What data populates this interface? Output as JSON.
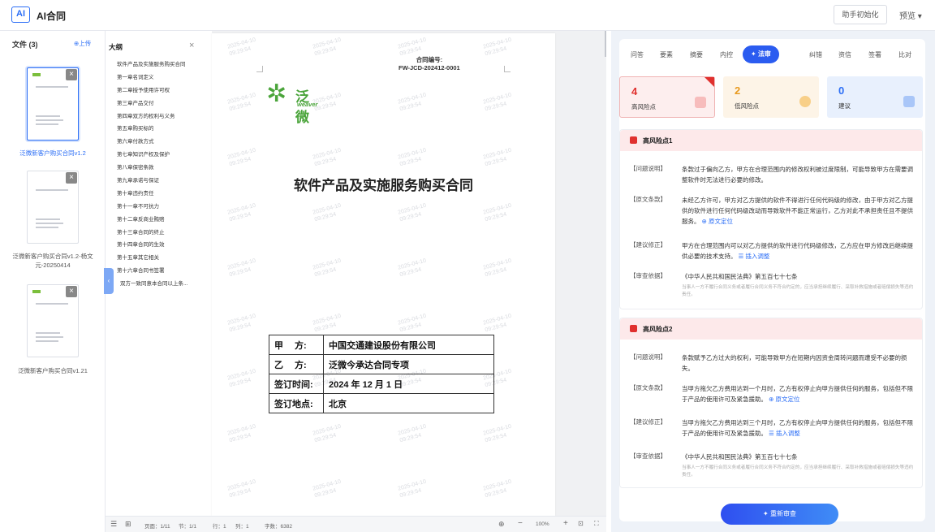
{
  "app": {
    "logo": "AI",
    "title": "AI合同",
    "init_button": "助手初始化",
    "preview_button": "预览 ▾"
  },
  "files": {
    "title": "文件 (3)",
    "upload": "⊕上传",
    "items": [
      {
        "name": "泛微新客户购买合同v1.2"
      },
      {
        "name": "泛微新客户购买合同v1.2-杨文元-20250414"
      },
      {
        "name": "泛微新客户购买合同v1.21"
      }
    ]
  },
  "outline": {
    "title": "大纲",
    "items": [
      "软件产品及实施服务购买合同",
      "第一章名词定义",
      "第二章授予使用许可权",
      "第三章产品交付",
      "第四章双方的权利与义务",
      "第五章购买标的",
      "第六章付款方式",
      "第七章知识产权及保护",
      "第八章保密条款",
      "第九章承诺与保证",
      "第十章违约责任",
      "第十一章不可抗力",
      "第十二章反商业贿赂",
      "第十三章合同的终止",
      "第十四章合同的生效",
      "第十五章其它相关",
      "第十六章合同书签署",
      "双方一致同意本合同以上条..."
    ]
  },
  "document": {
    "contract_no_label": "合同编号:",
    "contract_no": "FW-JCD-202412-0001",
    "brand_cn": "泛微",
    "brand_en": "weaver",
    "title": "软件产品及实施服务购买合同",
    "watermark_date": "2025-04-10",
    "watermark_time": "09:29:54",
    "parties": [
      {
        "k": "甲　 方:",
        "v": "中国交通建设股份有限公司"
      },
      {
        "k": "乙　 方:",
        "v": "泛微今承达合同专项"
      },
      {
        "k": "签订时间:",
        "v": "2024 年 12 月 1 日"
      },
      {
        "k": "签订地点:",
        "v": "北京"
      }
    ]
  },
  "statusbar": {
    "page": "页面：1/11",
    "section": "节：1/1",
    "row": "行：1",
    "col": "列：1",
    "words": "字数：6382",
    "zoom": "100%"
  },
  "review": {
    "tabs": [
      "问答",
      "要素",
      "摘要",
      "内控",
      "法审",
      "纠错",
      "资信",
      "签署",
      "比对"
    ],
    "active_tab": "法审",
    "stats": [
      {
        "num": "4",
        "label": "高风险点",
        "color": "#e0302e"
      },
      {
        "num": "2",
        "label": "低风险点",
        "color": "#e89a1f"
      },
      {
        "num": "0",
        "label": "建议",
        "color": "#2b6ef6"
      }
    ],
    "risks": [
      {
        "title": "高风险点1",
        "issue_k": "【问题说明】",
        "issue": "条款过于偏向乙方，甲方在合理范围内的修改权利被过度限制，可能导致甲方在需要调整软件时无法进行必要的修改。",
        "orig_k": "【原文条款】",
        "orig": "未经乙方许可，甲方对乙方提供的软件不得进行任何代码级的修改，由于甲方对乙方提供的软件进行任何代码级改动而导致软件不能正常运行，乙方对此不承担责任且不提供服务。",
        "orig_link": "⊕ 原文定位",
        "fix_k": "【建议修正】",
        "fix": "甲方在合理范围内可以对乙方提供的软件进行代码级修改，乙方应在甲方修改后继续提供必要的技术支持。",
        "fix_link": "☰ 插入调整",
        "basis_k": "【审查依据】",
        "basis": "《中华人民共和国民法典》第五百七十七条",
        "basis_detail": "当事人一方不履行合同义务或者履行合同义务不符合约定的，应当承担继续履行、采取补救措施或者赔偿损失等违约责任。"
      },
      {
        "title": "高风险点2",
        "issue_k": "【问题说明】",
        "issue": "条款赋予乙方过大的权利，可能导致甲方在短期内因资金周转问题而遭受不必要的损失。",
        "orig_k": "【原文条款】",
        "orig": "当甲方拖欠乙方费用达到一个月时，乙方有权停止向甲方提供任何的服务，包括但不限于产品的使用许可及紧急援助。",
        "orig_link": "⊕ 原文定位",
        "fix_k": "【建议修正】",
        "fix": "当甲方拖欠乙方费用达到三个月时，乙方有权停止向甲方提供任何的服务，包括但不限于产品的使用许可及紧急援助。",
        "fix_link": "☰ 插入调整",
        "basis_k": "【审查依据】",
        "basis": "《中华人民共和国民法典》第五百七十七条",
        "basis_detail": "当事人一方不履行合同义务或者履行合同义务不符合约定的，应当承担继续履行、采取补救措施或者赔偿损失等违约责任。"
      }
    ],
    "recheck": "✦ 重新审查"
  }
}
